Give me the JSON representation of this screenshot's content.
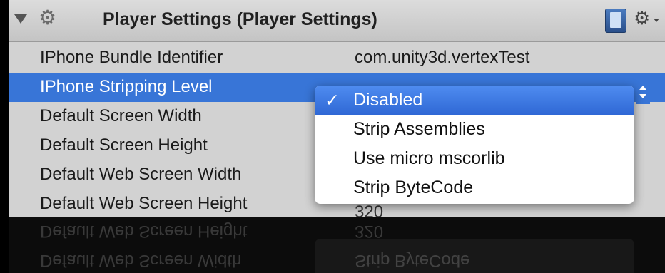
{
  "header": {
    "title": "Player Settings (Player Settings)"
  },
  "rows": [
    {
      "label": "IPhone Bundle Identifier",
      "value": "com.unity3d.vertexTest"
    },
    {
      "label": "IPhone Stripping Level",
      "value": ""
    },
    {
      "label": "Default Screen Width",
      "value": ""
    },
    {
      "label": "Default Screen Height",
      "value": ""
    },
    {
      "label": "Default Web Screen Width",
      "value": ""
    },
    {
      "label": "Default Web Screen Height",
      "value": "320"
    }
  ],
  "dropdown": {
    "selected_index": 0,
    "options": [
      "Disabled",
      "Strip Assemblies",
      "Use micro mscorlib",
      "Strip ByteCode"
    ]
  },
  "icons": {
    "disclosure": "disclosure-triangle-icon",
    "component": "gear-icon",
    "help": "help-book-icon",
    "settings": "gear-menu-icon"
  },
  "colors": {
    "selection": "#3875d7",
    "panel": "#d2d2d2",
    "background": "#000000"
  }
}
